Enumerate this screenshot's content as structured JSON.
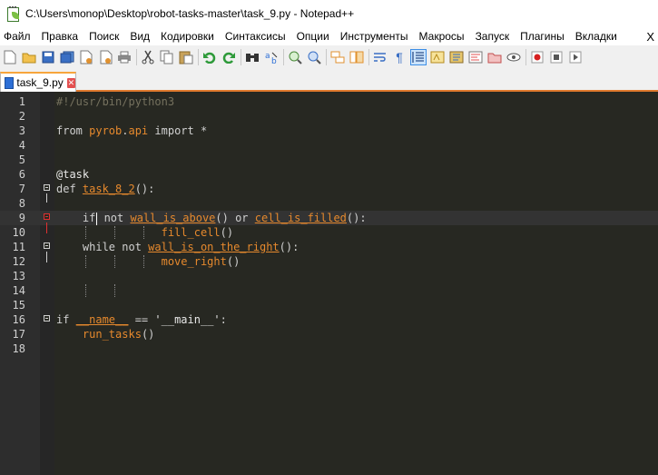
{
  "window": {
    "title": "C:\\Users\\monop\\Desktop\\robot-tasks-master\\task_9.py - Notepad++"
  },
  "menu": {
    "items": [
      "Файл",
      "Правка",
      "Поиск",
      "Вид",
      "Кодировки",
      "Синтаксисы",
      "Опции",
      "Инструменты",
      "Макросы",
      "Запуск",
      "Плагины",
      "Вкладки"
    ],
    "close": "X"
  },
  "toolbar": {
    "icons": [
      "new-file-icon",
      "open-file-icon",
      "save-icon",
      "save-all-icon",
      "close-file-icon",
      "close-all-icon",
      "print-icon",
      "cut-icon",
      "copy-icon",
      "paste-icon",
      "undo-icon",
      "redo-icon",
      "find-icon",
      "replace-icon",
      "zoom-in-icon",
      "zoom-out-icon",
      "sync-vertical-icon",
      "sync-horizontal-icon",
      "word-wrap-icon",
      "show-all-chars-icon",
      "indent-guide-icon",
      "language-icon",
      "function-list-icon",
      "doc-map-icon",
      "folder-icon",
      "monitor-icon",
      "record-macro-icon",
      "stop-macro-icon",
      "play-macro-icon"
    ]
  },
  "tab": {
    "label": "task_9.py",
    "close": "✕"
  },
  "editor": {
    "current_line": 9,
    "lines": [
      {
        "n": "1",
        "text": "#!/usr/bin/python3"
      },
      {
        "n": "2",
        "text": ""
      },
      {
        "n": "3",
        "text": "from pyrob.api import *"
      },
      {
        "n": "4",
        "text": ""
      },
      {
        "n": "5",
        "text": ""
      },
      {
        "n": "6",
        "text": "@task"
      },
      {
        "n": "7",
        "text": "def task_8_2():"
      },
      {
        "n": "8",
        "text": ""
      },
      {
        "n": "9",
        "text": "    if not wall_is_above() or cell_is_filled():"
      },
      {
        "n": "10",
        "text": "                fill_cell()"
      },
      {
        "n": "11",
        "text": "    while not wall_is_on_the_right():"
      },
      {
        "n": "12",
        "text": "                move_right()"
      },
      {
        "n": "13",
        "text": ""
      },
      {
        "n": "14",
        "text": ""
      },
      {
        "n": "15",
        "text": ""
      },
      {
        "n": "16",
        "text": "if __name__ == '__main__':"
      },
      {
        "n": "17",
        "text": "    run_tasks()"
      },
      {
        "n": "18",
        "text": ""
      }
    ]
  },
  "colors": {
    "editor_bg": "#272822",
    "identifier": "#e6892d",
    "comment": "#75715e",
    "text": "#d0d0d0",
    "tab_accent": "#f7a53c"
  }
}
